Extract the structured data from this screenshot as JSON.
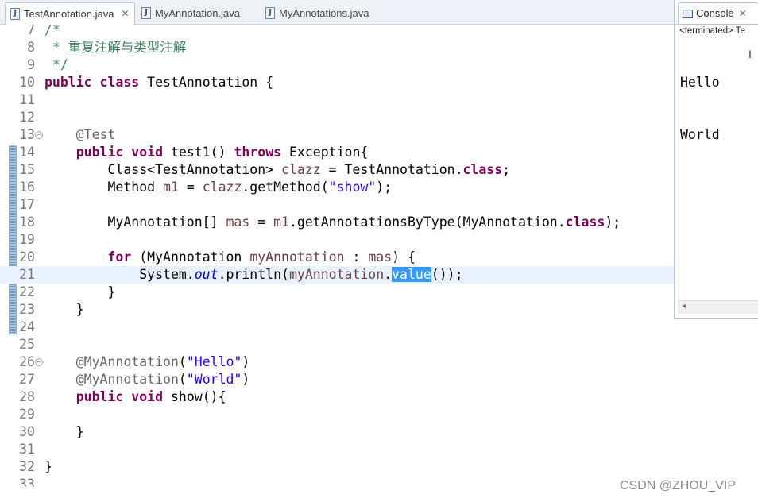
{
  "editor": {
    "tabs": [
      {
        "label": "TestAnnotation.java",
        "active": true
      },
      {
        "label": "MyAnnotation.java",
        "active": false
      },
      {
        "label": "MyAnnotations.java",
        "active": false
      }
    ],
    "lines": [
      {
        "num": "7",
        "code": "/*"
      },
      {
        "num": "8",
        "code": " * 重复注解与类型注解"
      },
      {
        "num": "9",
        "code": " */"
      },
      {
        "num": "10",
        "code": "public class TestAnnotation {"
      },
      {
        "num": "11",
        "code": ""
      },
      {
        "num": "12",
        "code": ""
      },
      {
        "num": "13",
        "code": "    @Test"
      },
      {
        "num": "14",
        "code": "    public void test1() throws Exception{"
      },
      {
        "num": "15",
        "code": "        Class<TestAnnotation> clazz = TestAnnotation.class;"
      },
      {
        "num": "16",
        "code": "        Method m1 = clazz.getMethod(\"show\");"
      },
      {
        "num": "17",
        "code": ""
      },
      {
        "num": "18",
        "code": "        MyAnnotation[] mas = m1.getAnnotationsByType(MyAnnotation.class);"
      },
      {
        "num": "19",
        "code": ""
      },
      {
        "num": "20",
        "code": "        for (MyAnnotation myAnnotation : mas) {"
      },
      {
        "num": "21",
        "code": "            System.out.println(myAnnotation.value());"
      },
      {
        "num": "22",
        "code": "        }"
      },
      {
        "num": "23",
        "code": "    }"
      },
      {
        "num": "24",
        "code": ""
      },
      {
        "num": "25",
        "code": ""
      },
      {
        "num": "26",
        "code": "    @MyAnnotation(\"Hello\")"
      },
      {
        "num": "27",
        "code": "    @MyAnnotation(\"World\")"
      },
      {
        "num": "28",
        "code": "    public void show(){"
      },
      {
        "num": "29",
        "code": ""
      },
      {
        "num": "30",
        "code": "    }"
      },
      {
        "num": "31",
        "code": ""
      },
      {
        "num": "32",
        "code": "}"
      },
      {
        "num": "33",
        "code": ""
      }
    ],
    "highlighted_line": "21",
    "selected_text": "value",
    "fold_lines": [
      "13",
      "26"
    ]
  },
  "console": {
    "tab_label": "Console",
    "status": "<terminated> Te",
    "output": [
      "Hello",
      "World"
    ]
  },
  "watermark": "CSDN @ZHOU_VIP",
  "colors": {
    "keyword": "#7f0055",
    "comment": "#3f7f5f",
    "annotation": "#646464",
    "string": "#2a00ff",
    "selection": "#3399ff",
    "current_line": "#e8f2fe"
  }
}
